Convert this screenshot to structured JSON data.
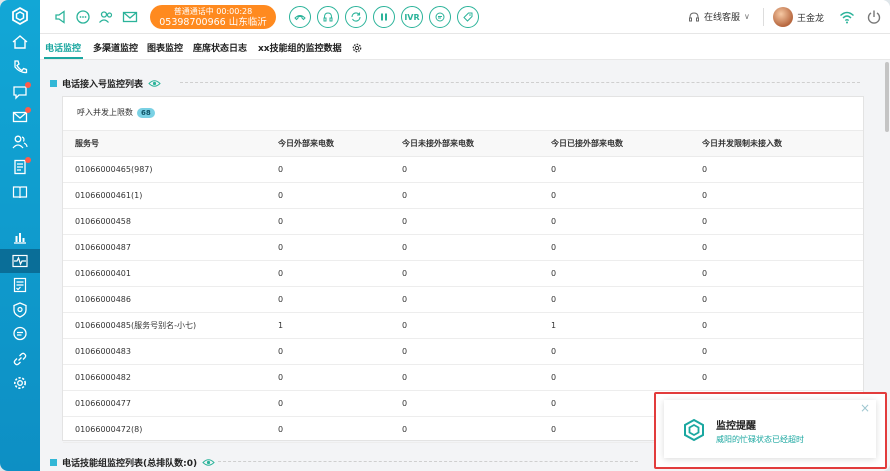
{
  "header": {
    "call_status": "普通通话中  00:00:28",
    "call_number": "05398700966 山东临沂",
    "ivr_label": "IVR",
    "online_status": "在线客服",
    "user_name": "王金龙"
  },
  "tabs": [
    {
      "label": "电话监控",
      "active": true
    },
    {
      "label": "多渠道监控"
    },
    {
      "label": "图表监控"
    },
    {
      "label": "座席状态日志"
    },
    {
      "label": "xx技能组的监控数据"
    }
  ],
  "section1": {
    "title": "电话接入号监控列表",
    "concurrency_label": "呼入并发上限数",
    "concurrency_value": "68",
    "columns": [
      "服务号",
      "今日外部来电数",
      "今日未接外部来电数",
      "今日已接外部来电数",
      "今日并发限制未接入数"
    ],
    "rows": [
      [
        "01066000465(987)",
        "0",
        "0",
        "0",
        "0"
      ],
      [
        "01066000461(1)",
        "0",
        "0",
        "0",
        "0"
      ],
      [
        "01066000458",
        "0",
        "0",
        "0",
        "0"
      ],
      [
        "01066000487",
        "0",
        "0",
        "0",
        "0"
      ],
      [
        "01066000401",
        "0",
        "0",
        "0",
        "0"
      ],
      [
        "01066000486",
        "0",
        "0",
        "0",
        "0"
      ],
      [
        "01066000485(服务号别名-小七)",
        "1",
        "0",
        "1",
        "0"
      ],
      [
        "01066000483",
        "0",
        "0",
        "0",
        "0"
      ],
      [
        "01066000482",
        "0",
        "0",
        "0",
        "0"
      ],
      [
        "01066000477",
        "0",
        "0",
        "0",
        "0"
      ],
      [
        "01066000472(8)",
        "0",
        "0",
        "0",
        "0"
      ]
    ]
  },
  "section2": {
    "title": "电话技能组监控列表(总排队数:0)"
  },
  "toast": {
    "title": "监控提醒",
    "message": "威阳的忙碌状态已经超时",
    "close": "×"
  },
  "colors": {
    "sidebar": "#12a7d6",
    "accent": "#1aa7a0",
    "call_pill": "#ff8a1f",
    "alert_border": "#e23c3c"
  }
}
